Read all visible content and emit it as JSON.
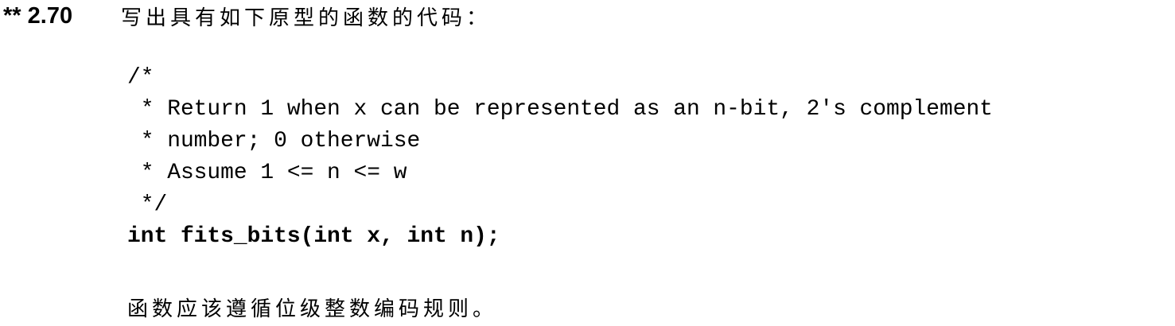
{
  "exercise": {
    "number": "** 2.70",
    "prompt": "写出具有如下原型的函数的代码：",
    "code_lines": [
      "/*",
      " * Return 1 when x can be represented as an n-bit, 2's complement",
      " * number; 0 otherwise",
      " * Assume 1 <= n <= w",
      " */"
    ],
    "prototype": "int fits_bits(int x, int n);",
    "note": "函数应该遵循位级整数编码规则。"
  }
}
